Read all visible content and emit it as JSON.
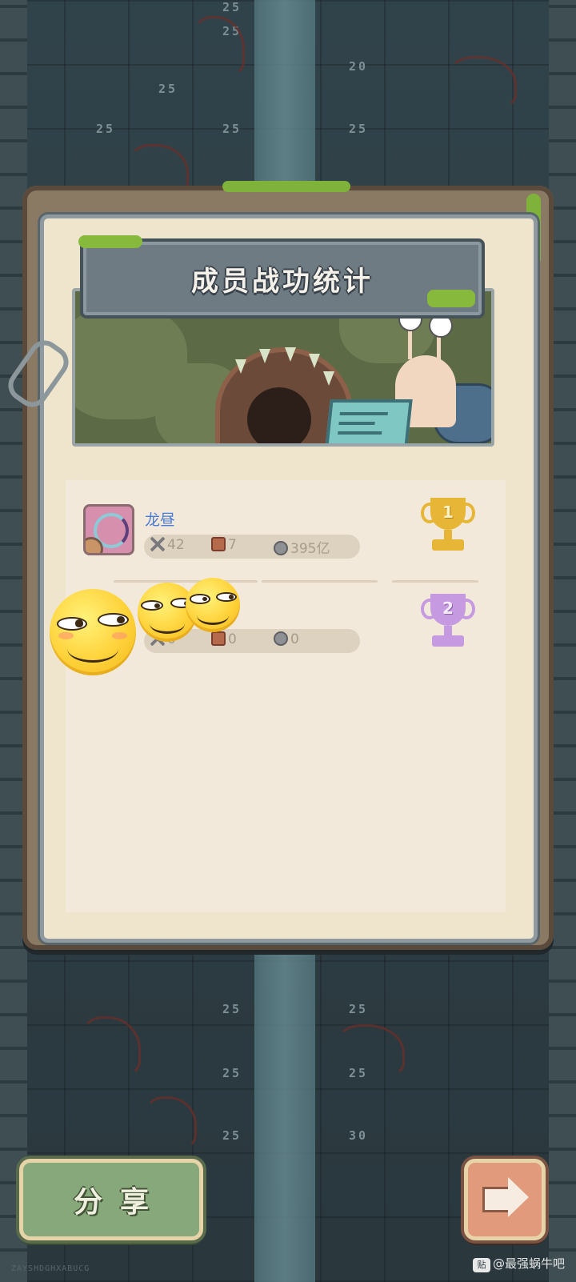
{
  "title": "成员战功统计",
  "background": {
    "tile_numbers": [
      "25",
      "20",
      "25",
      "25",
      "25",
      "25",
      "25",
      "25",
      "25",
      "30",
      "25",
      "25",
      "25"
    ]
  },
  "members": [
    {
      "name": "龙昼",
      "attacks": "42",
      "scrolls": "7",
      "damage": "395亿",
      "rank": "1"
    },
    {
      "name": "",
      "attacks": "0",
      "scrolls": "0",
      "damage": "0",
      "rank": "2"
    }
  ],
  "buttons": {
    "share": "分享",
    "next_icon": "arrow-right-icon"
  },
  "footer": {
    "code": "ZAYSHDGHXABUCG",
    "watermark": "@最强蜗牛吧",
    "tieba_badge": "贴"
  },
  "colors": {
    "member_name": "#4b7dd6",
    "gold_trophy": "#e8b636",
    "silver_trophy": "#c59ae0",
    "share_button": "#86a87a",
    "next_button": "#e29a7c"
  }
}
